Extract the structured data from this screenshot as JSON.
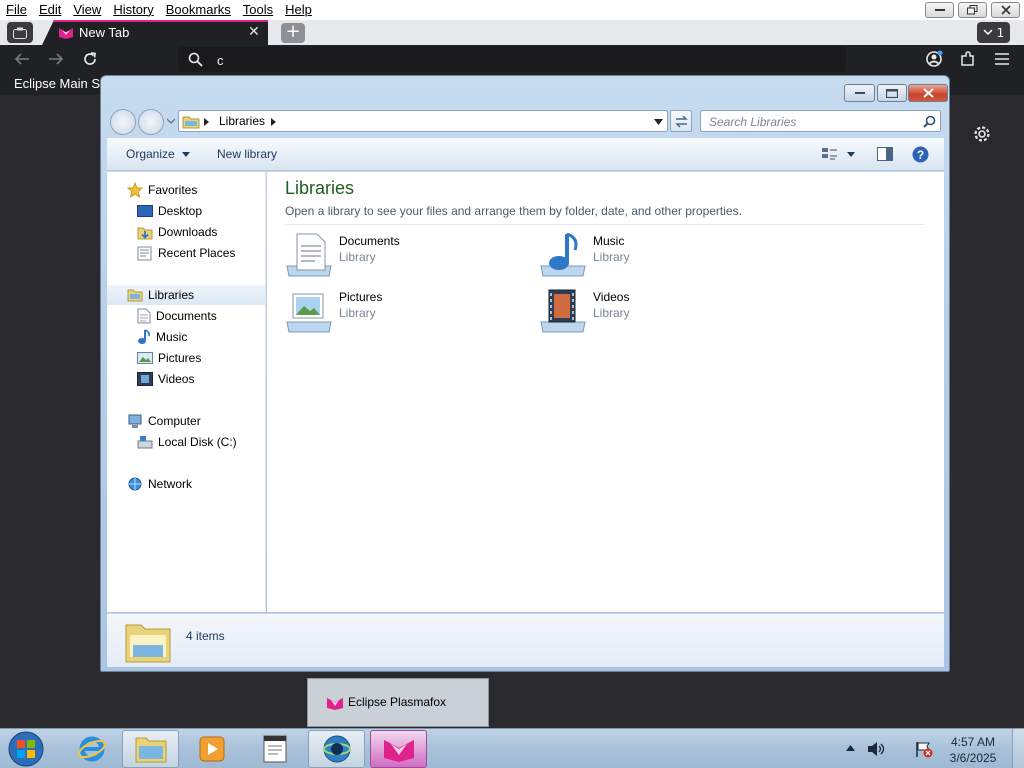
{
  "browser": {
    "menu": [
      "File",
      "Edit",
      "View",
      "History",
      "Bookmarks",
      "Tools",
      "Help"
    ],
    "tab": {
      "title": "New Tab",
      "accent_color": "#e0228b"
    },
    "tab_count": "1",
    "url_text": "c",
    "bookmark": "Eclipse Main S"
  },
  "explorer": {
    "address": {
      "crumb": "Libraries"
    },
    "search_placeholder": "Search Libraries",
    "toolbar": {
      "organize": "Organize",
      "new_library": "New library"
    },
    "nav": {
      "favorites": "Favorites",
      "favorite_items": [
        "Desktop",
        "Downloads",
        "Recent Places"
      ],
      "libraries": "Libraries",
      "library_items": [
        "Documents",
        "Music",
        "Pictures",
        "Videos"
      ],
      "computer": "Computer",
      "computer_items": [
        "Local Disk (C:)"
      ],
      "network": "Network"
    },
    "content": {
      "title": "Libraries",
      "subtitle": "Open a library to see your files and arrange them by folder, date, and other properties.",
      "items": [
        {
          "name": "Documents",
          "type": "Library",
          "icon": "documents-library-icon"
        },
        {
          "name": "Music",
          "type": "Library",
          "icon": "music-library-icon"
        },
        {
          "name": "Pictures",
          "type": "Library",
          "icon": "pictures-library-icon"
        },
        {
          "name": "Videos",
          "type": "Library",
          "icon": "videos-library-icon"
        }
      ]
    },
    "details": {
      "count": "4 items"
    }
  },
  "taskbar": {
    "preview_label": "Eclipse Plasmafox",
    "clock_time": "4:57 AM",
    "clock_date": "3/6/2025"
  }
}
